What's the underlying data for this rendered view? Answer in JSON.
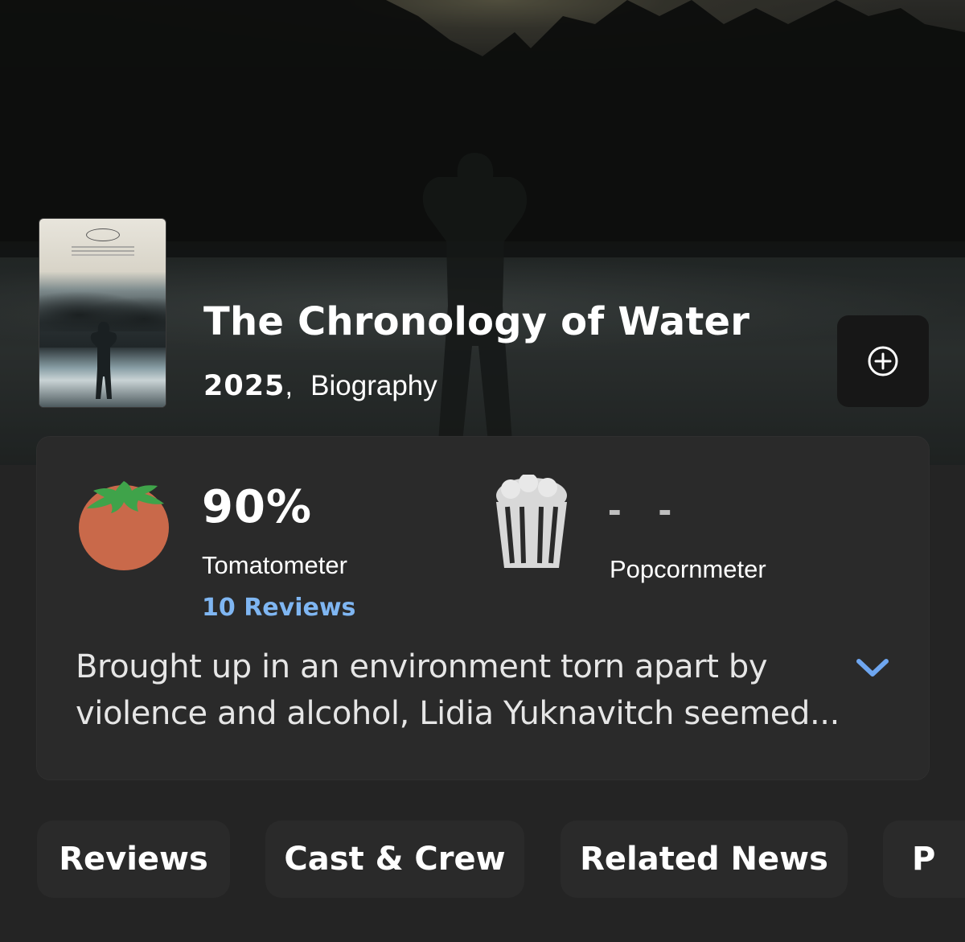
{
  "movie": {
    "title": "The Chronology of Water",
    "year": "2025",
    "separator": ",",
    "genre": "Biography"
  },
  "scores": {
    "tomatometer": {
      "value": "90%",
      "label": "Tomatometer",
      "reviews": "10 Reviews",
      "icon": "tomato-icon"
    },
    "popcornmeter": {
      "value": "- -",
      "label": "Popcornmeter",
      "icon": "popcorn-icon"
    }
  },
  "synopsis": {
    "text": "Brought up in an environment torn apart by violence and alcohol, Lidia Yuknavitch seemed...",
    "expand_icon": "chevron-down-icon"
  },
  "tabs": [
    {
      "label": "Reviews"
    },
    {
      "label": "Cast & Crew"
    },
    {
      "label": "Related News"
    },
    {
      "label": "P"
    }
  ],
  "colors": {
    "background": "#242424",
    "card": "#2a2a2a",
    "link": "#7fb6f2",
    "tomato": "#c9694a",
    "tomato_leaf": "#3fa34a"
  }
}
